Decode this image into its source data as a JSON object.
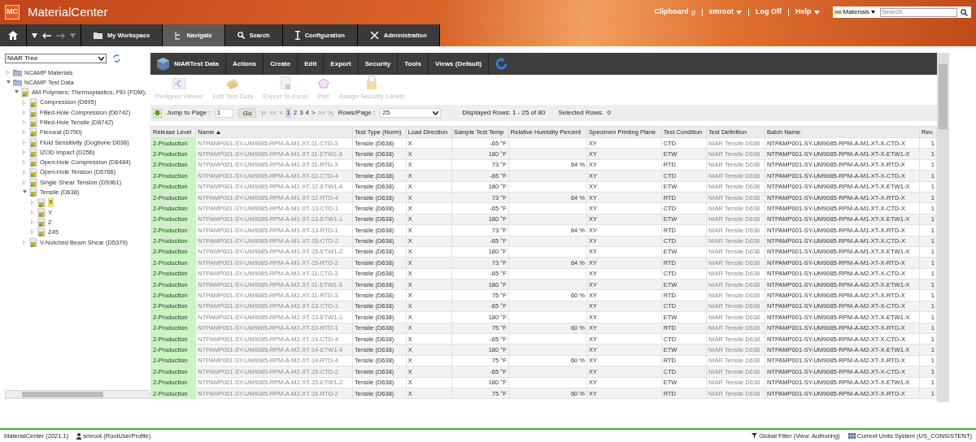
{
  "app": {
    "logo": "MC",
    "title": "MaterialCenter"
  },
  "header_links": [
    {
      "label": "Clipboard",
      "kind": "clip"
    },
    {
      "label": "smroot",
      "kind": "menu"
    },
    {
      "label": "Log Off",
      "kind": "plain"
    },
    {
      "label": "Help",
      "kind": "menu"
    }
  ],
  "domain_select": {
    "value": "Materials"
  },
  "global_search": {
    "placeholder": "Search"
  },
  "nav_tabs": [
    {
      "label": "My Workspace",
      "kind": "folder",
      "selected": false
    },
    {
      "label": "Navigate",
      "kind": "tree",
      "selected": true
    },
    {
      "label": "Search",
      "kind": "search",
      "selected": false
    },
    {
      "label": "Configuration",
      "kind": "config",
      "selected": false
    },
    {
      "label": "Administration",
      "kind": "admin",
      "selected": false
    }
  ],
  "tree_select": {
    "value": "NIAR Tree"
  },
  "tree": [
    {
      "label": "NCAMP Materials",
      "kind": "folder",
      "expanded": false,
      "selected": false
    },
    {
      "label": "NCAMP Test Data",
      "kind": "folder",
      "expanded": true,
      "selected": false,
      "children": [
        {
          "label": "AM Polymers; Thermoplastics; PEI (FDM);",
          "kind": "data",
          "expanded": true,
          "selected": false,
          "children": [
            {
              "label": "Compression (D695)",
              "kind": "data",
              "expanded": false,
              "selected": false
            },
            {
              "label": "Filled-Hole Compression (D6742)",
              "kind": "data",
              "expanded": false,
              "selected": false
            },
            {
              "label": "Filled-Hole Tensile (D6742)",
              "kind": "data",
              "expanded": false,
              "selected": false
            },
            {
              "label": "Flexural (D790)",
              "kind": "data",
              "expanded": false,
              "selected": false
            },
            {
              "label": "Fluid Sensitivity (Dogbone D638)",
              "kind": "data",
              "expanded": false,
              "selected": false
            },
            {
              "label": "IZOD Impact (D256)",
              "kind": "data",
              "expanded": false,
              "selected": false
            },
            {
              "label": "Open-Hole Compression (D6484)",
              "kind": "data",
              "expanded": false,
              "selected": false
            },
            {
              "label": "Open-Hole Tension (D5766)",
              "kind": "data",
              "expanded": false,
              "selected": false
            },
            {
              "label": "Single Shear Tension (D5961)",
              "kind": "data",
              "expanded": false,
              "selected": false
            },
            {
              "label": "Tensile (D638)",
              "kind": "data",
              "expanded": true,
              "selected": false,
              "children": [
                {
                  "label": "X",
                  "kind": "data",
                  "expanded": false,
                  "selected": true
                },
                {
                  "label": "Y",
                  "kind": "data",
                  "expanded": false,
                  "selected": false
                },
                {
                  "label": "Z",
                  "kind": "data",
                  "expanded": false,
                  "selected": false
                },
                {
                  "label": "Z45",
                  "kind": "data",
                  "expanded": false,
                  "selected": false
                }
              ]
            },
            {
              "label": "V-Notched Beam Shear (D5379)",
              "kind": "data",
              "expanded": false,
              "selected": false
            }
          ]
        }
      ]
    }
  ],
  "menu_bar": {
    "title": "NIARTest Data",
    "items": [
      "Actions",
      "Create",
      "Edit",
      "Export",
      "Security",
      "Tools",
      "Views (Default)"
    ]
  },
  "toolbar": [
    {
      "label": "Pedigree Viewer",
      "kind": "pedigree",
      "disabled": true
    },
    {
      "label": "Edit Test Data",
      "kind": "edit",
      "disabled": true
    },
    {
      "label": "Export To Excel",
      "kind": "excel",
      "disabled": true
    },
    {
      "label": "Plot",
      "kind": "plot",
      "disabled": true
    },
    {
      "label": "Assign Security Labels",
      "kind": "lock",
      "disabled": true
    }
  ],
  "pager": {
    "jump_label": "Jump to Page :",
    "page_value": "1",
    "go": "Go",
    "nav_first": [
      {
        "label": "|<",
        "disabled": true
      },
      {
        "label": "<<",
        "disabled": true
      },
      {
        "label": "<",
        "disabled": true
      }
    ],
    "pages": [
      {
        "label": "1",
        "selected": true
      },
      {
        "label": "2",
        "selected": false
      },
      {
        "label": "3",
        "selected": false
      },
      {
        "label": "4",
        "selected": false
      }
    ],
    "nav_last": [
      {
        "label": ">",
        "disabled": false
      },
      {
        "label": ">>",
        "disabled": true
      },
      {
        "label": ">|",
        "disabled": true
      }
    ],
    "rows_label": "Rows/Page :",
    "rows_value": "25",
    "displayed": "Displayed Rows: 1 - 25 of 80",
    "selected_rows": "Selected Rows:  0"
  },
  "table": {
    "columns": [
      {
        "label": "Release Level",
        "sorted": false
      },
      {
        "label": "Name",
        "sorted": true
      },
      {
        "label": "Test Type (Norm)",
        "sorted": false
      },
      {
        "label": "Load Direction",
        "sorted": false
      },
      {
        "label": "Sample Test Temp",
        "sorted": false
      },
      {
        "label": "Relative Humidity Percent",
        "sorted": false
      },
      {
        "label": "Specimen Printing Plane",
        "sorted": false
      },
      {
        "label": "Test Condition",
        "sorted": false
      },
      {
        "label": "Test Definition",
        "sorted": false
      },
      {
        "label": "Batch Name",
        "sorted": false
      },
      {
        "label": "Rev.",
        "sorted": false
      }
    ],
    "rows": [
      [
        "2-Production",
        "NTPAMP001-SY-UM9085-RPM-A-M1-XT-11-CTD-3",
        "Tensile (D638)",
        "X",
        "-65 °F",
        null,
        "XY",
        "CTD",
        "NIAR Tensile D638",
        "NTPAMP001-SY-UM9085-RPM-A-M1-XT-X-CTD-X",
        "1"
      ],
      [
        "2-Production",
        "NTPAMP001-SY-UM9085-RPM-A-M1-XT-11-ETW1-3",
        "Tensile (D638)",
        "X",
        "180 °F",
        null,
        "XY",
        "ETW",
        "NIAR Tensile D638",
        "NTPAMP001-SY-UM9085-RPM-A-M1-XT-X-ETW1-X",
        "1"
      ],
      [
        "2-Production",
        "NTPAMP001-SY-UM9085-RPM-A-M1-XT-11-RTD-3",
        "Tensile (D638)",
        "X",
        "73 °F",
        "64 %",
        "XY",
        "RTD",
        "NIAR Tensile D638",
        "NTPAMP001-SY-UM9085-RPM-A-M1-XT-X-RTD-X",
        "1"
      ],
      [
        "2-Production",
        "NTPAMP001-SY-UM9085-RPM-A-M1-XT-12-CTD-4",
        "Tensile (D638)",
        "X",
        "-65 °F",
        null,
        "XY",
        "CTD",
        "NIAR Tensile D638",
        "NTPAMP001-SY-UM9085-RPM-A-M1-XT-X-CTD-X",
        "1"
      ],
      [
        "2-Production",
        "NTPAMP001-SY-UM9085-RPM-A-M1-XT-12-ETW1-4",
        "Tensile (D638)",
        "X",
        "180 °F",
        null,
        "XY",
        "ETW",
        "NIAR Tensile D638",
        "NTPAMP001-SY-UM9085-RPM-A-M1-XT-X-ETW1-X",
        "1"
      ],
      [
        "2-Production",
        "NTPAMP001-SY-UM9085-RPM-A-M1-XT-12-RTD-4",
        "Tensile (D638)",
        "X",
        "73 °F",
        "64 %",
        "XY",
        "RTD",
        "NIAR Tensile D638",
        "NTPAMP001-SY-UM9085-RPM-A-M1-XT-X-RTD-X",
        "1"
      ],
      [
        "2-Production",
        "NTPAMP001-SY-UM9085-RPM-A-M1-XT-13-CTD-1",
        "Tensile (D638)",
        "X",
        "-65 °F",
        null,
        "XY",
        "CTD",
        "NIAR Tensile D638",
        "NTPAMP001-SY-UM9085-RPM-A-M1-XT-X-CTD-X",
        "1"
      ],
      [
        "2-Production",
        "NTPAMP001-SY-UM9085-RPM-A-M1-XT-13-ETW1-1",
        "Tensile (D638)",
        "X",
        "180 °F",
        null,
        "XY",
        "ETW",
        "NIAR Tensile D638",
        "NTPAMP001-SY-UM9085-RPM-A-M1-XT-X-ETW1-X",
        "1"
      ],
      [
        "2-Production",
        "NTPAMP001-SY-UM9085-RPM-A-M1-XT-13-RTD-1",
        "Tensile (D638)",
        "X",
        "73 °F",
        "64 %",
        "XY",
        "RTD",
        "NIAR Tensile D638",
        "NTPAMP001-SY-UM9085-RPM-A-M1-XT-X-RTD-X",
        "1"
      ],
      [
        "2-Production",
        "NTPAMP001-SY-UM9085-RPM-A-M1-XT-15-CTD-2",
        "Tensile (D638)",
        "X",
        "-65 °F",
        null,
        "XY",
        "CTD",
        "NIAR Tensile D638",
        "NTPAMP001-SY-UM9085-RPM-A-M1-XT-X-CTD-X",
        "1"
      ],
      [
        "2-Production",
        "NTPAMP001-SY-UM9085-RPM-A-M1-XT-15-ETW1-2",
        "Tensile (D638)",
        "X",
        "180 °F",
        null,
        "XY",
        "ETW",
        "NIAR Tensile D638",
        "NTPAMP001-SY-UM9085-RPM-A-M1-XT-X-ETW1-X",
        "1"
      ],
      [
        "2-Production",
        "NTPAMP001-SY-UM9085-RPM-A-M1-XT-15-RTD-2",
        "Tensile (D638)",
        "X",
        "73 °F",
        "64 %",
        "XY",
        "RTD",
        "NIAR Tensile D638",
        "NTPAMP001-SY-UM9085-RPM-A-M1-XT-X-RTD-X",
        "1"
      ],
      [
        "2-Production",
        "NTPAMP001-SY-UM9085-RPM-A-M2-XT-11-CTD-3",
        "Tensile (D638)",
        "X",
        "-65 °F",
        null,
        "XY",
        "CTD",
        "NIAR Tensile D638",
        "NTPAMP001-SY-UM9085-RPM-A-M2-XT-X-CTD-X",
        "1"
      ],
      [
        "2-Production",
        "NTPAMP001-SY-UM9085-RPM-A-M2-XT-11-ETW1-3",
        "Tensile (D638)",
        "X",
        "180 °F",
        null,
        "XY",
        "ETW",
        "NIAR Tensile D638",
        "NTPAMP001-SY-UM9085-RPM-A-M2-XT-X-ETW1-X",
        "1"
      ],
      [
        "2-Production",
        "NTPAMP001-SY-UM9085-RPM-A-M2-XT-11-RTD-3",
        "Tensile (D638)",
        "X",
        "75 °F",
        "60 %",
        "XY",
        "RTD",
        "NIAR Tensile D638",
        "NTPAMP001-SY-UM9085-RPM-A-M2-XT-X-RTD-X",
        "1"
      ],
      [
        "2-Production",
        "NTPAMP001-SY-UM9085-RPM-A-M2-XT-13-CTD-1",
        "Tensile (D638)",
        "X",
        "-65 °F",
        null,
        "XY",
        "CTD",
        "NIAR Tensile D638",
        "NTPAMP001-SY-UM9085-RPM-A-M2-XT-X-CTD-X",
        "1"
      ],
      [
        "2-Production",
        "NTPAMP001-SY-UM9085-RPM-A-M2-XT-13-ETW1-1",
        "Tensile (D638)",
        "X",
        "180 °F",
        null,
        "XY",
        "ETW",
        "NIAR Tensile D638",
        "NTPAMP001-SY-UM9085-RPM-A-M2-XT-X-ETW1-X",
        "1"
      ],
      [
        "2-Production",
        "NTPAMP001-SY-UM9085-RPM-A-M2-XT-13-RTD-1",
        "Tensile (D638)",
        "X",
        "75 °F",
        "60 %",
        "XY",
        "RTD",
        "NIAR Tensile D638",
        "NTPAMP001-SY-UM9085-RPM-A-M2-XT-X-RTD-X",
        "1"
      ],
      [
        "2-Production",
        "NTPAMP001-SY-UM9085-RPM-A-M2-XT-14-CTD-4",
        "Tensile (D638)",
        "X",
        "-65 °F",
        null,
        "XY",
        "CTD",
        "NIAR Tensile D638",
        "NTPAMP001-SY-UM9085-RPM-A-M2-XT-X-CTD-X",
        "1"
      ],
      [
        "2-Production",
        "NTPAMP001-SY-UM9085-RPM-A-M2-XT-14-ETW1-4",
        "Tensile (D638)",
        "X",
        "180 °F",
        null,
        "XY",
        "ETW",
        "NIAR Tensile D638",
        "NTPAMP001-SY-UM9085-RPM-A-M2-XT-X-ETW1-X",
        "1"
      ],
      [
        "2-Production",
        "NTPAMP001-SY-UM9085-RPM-A-M2-XT-14-RTD-4",
        "Tensile (D638)",
        "X",
        "75 °F",
        "60 %",
        "XY",
        "RTD",
        "NIAR Tensile D638",
        "NTPAMP001-SY-UM9085-RPM-A-M2-XT-X-RTD-X",
        "1"
      ],
      [
        "2-Production",
        "NTPAMP001-SY-UM9085-RPM-A-M2-XT-15-CTD-2",
        "Tensile (D638)",
        "X",
        "-65 °F",
        null,
        "XY",
        "CTD",
        "NIAR Tensile D638",
        "NTPAMP001-SY-UM9085-RPM-A-M2-XT-X-CTD-X",
        "1"
      ],
      [
        "2-Production",
        "NTPAMP001-SY-UM9085-RPM-A-M2-XT-15-ETW1-2",
        "Tensile (D638)",
        "X",
        "180 °F",
        null,
        "XY",
        "ETW",
        "NIAR Tensile D638",
        "NTPAMP001-SY-UM9085-RPM-A-M2-XT-X-ETW1-X",
        "1"
      ],
      [
        "2-Production",
        "NTPAMP001-SY-UM9085-RPM-A-M2-XT-15-RTD-2",
        "Tensile (D638)",
        "X",
        "75 °F",
        "60 %",
        "XY",
        "RTD",
        "NIAR Tensile D638",
        "NTPAMP001-SY-UM9085-RPM-A-M2-XT-X-RTD-X",
        "1"
      ]
    ]
  },
  "status_bar": [
    {
      "label": "MaterialCenter (2021.1)",
      "kind": "version"
    },
    {
      "label": "smroot (RootUserProfile)",
      "kind": "user"
    },
    {
      "label": "Global Filter (View: Authoring)",
      "kind": "filter"
    },
    {
      "label": "Current Units System (US_CONSISTENT)",
      "kind": "units"
    }
  ]
}
